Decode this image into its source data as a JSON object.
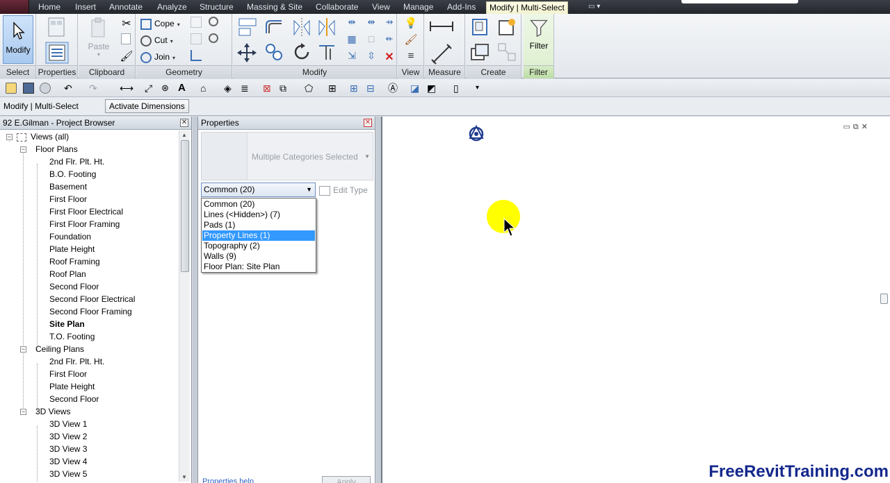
{
  "ribbon_tabs": [
    "Home",
    "Insert",
    "Annotate",
    "Analyze",
    "Structure",
    "Massing & Site",
    "Collaborate",
    "View",
    "Manage",
    "Add-Ins",
    "Modify | Multi-Select"
  ],
  "ribbon": {
    "select_panel": {
      "modify_label": "Modify",
      "panel_label": "Select"
    },
    "properties_panel": {
      "panel_label": "Properties"
    },
    "clipboard_panel": {
      "paste_label": "Paste",
      "panel_label": "Clipboard"
    },
    "geometry_panel": {
      "cope_label": "Cope",
      "cut_label": "Cut",
      "join_label": "Join",
      "panel_label": "Geometry"
    },
    "modify_panel": {
      "panel_label": "Modify"
    },
    "view_panel": {
      "panel_label": "View"
    },
    "measure_panel": {
      "panel_label": "Measure"
    },
    "create_panel": {
      "panel_label": "Create"
    },
    "filter_panel": {
      "filter_label": "Filter",
      "panel_label": "Filter"
    }
  },
  "options_bar": {
    "context_label": "Modify | Multi-Select",
    "activate_dimensions": "Activate Dimensions"
  },
  "project_browser": {
    "title": "92 E.Gilman - Project Browser",
    "root": "Views (all)",
    "floor_plans_label": "Floor Plans",
    "floor_plans": [
      "2nd Flr. Plt. Ht.",
      "B.O. Footing",
      "Basement",
      "First Floor",
      "First Floor Electrical",
      "First Floor Framing",
      "Foundation",
      "Plate Height",
      "Roof Framing",
      "Roof Plan",
      "Second Floor",
      "Second Floor Electrical",
      "Second Floor Framing",
      "Site Plan",
      "T.O. Footing"
    ],
    "active_view": "Site Plan",
    "ceiling_plans_label": "Ceiling Plans",
    "ceiling_plans": [
      "2nd Flr. Plt. Ht.",
      "First Floor",
      "Plate Height",
      "Second Floor"
    ],
    "views_3d_label": "3D Views",
    "views_3d": [
      "3D View 1",
      "3D View 2",
      "3D View 3",
      "3D View 4",
      "3D View 5"
    ]
  },
  "properties": {
    "title": "Properties",
    "type_selector": "Multiple Categories Selected",
    "filter_value": "Common (20)",
    "edit_type": "Edit Type",
    "dropdown_options": [
      "Common (20)",
      "Lines (<Hidden>) (7)",
      "Pads (1)",
      "Property Lines (1)",
      "Topography (2)",
      "Walls (9)",
      "Floor Plan: Site Plan"
    ],
    "dropdown_selected_index": 3,
    "help_link": "Properties help",
    "apply": "Apply"
  },
  "watermark": "FreeRevitTraining.com",
  "colors": {
    "accent": "#3399ff",
    "cursor_highlight": "#ffff00",
    "watermark": "#14288c"
  }
}
